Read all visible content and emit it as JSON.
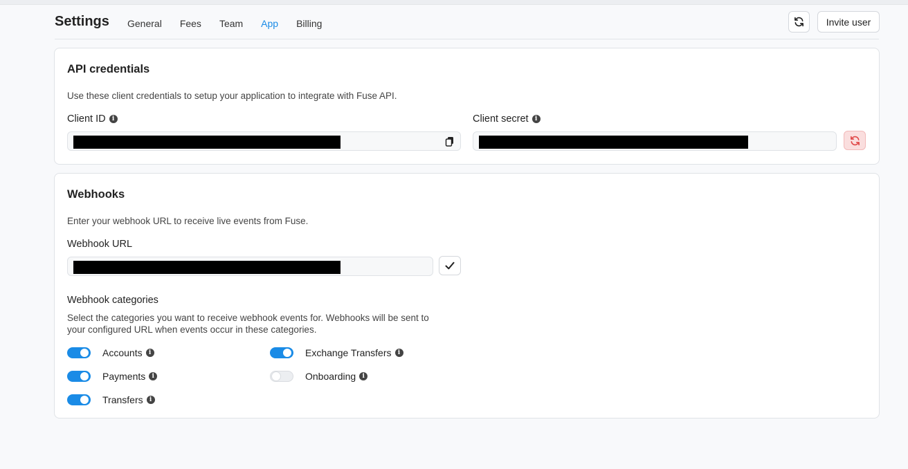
{
  "header": {
    "title": "Settings",
    "tabs": [
      {
        "label": "General",
        "active": false
      },
      {
        "label": "Fees",
        "active": false
      },
      {
        "label": "Team",
        "active": false
      },
      {
        "label": "App",
        "active": true
      },
      {
        "label": "Billing",
        "active": false
      }
    ],
    "refresh_icon": "refresh-icon",
    "invite_label": "Invite user"
  },
  "api": {
    "title": "API credentials",
    "description": "Use these client credentials to setup your application to integrate with Fuse API.",
    "client_id_label": "Client ID",
    "client_secret_label": "Client secret"
  },
  "webhooks": {
    "title": "Webhooks",
    "description": "Enter your webhook URL to receive live events from Fuse.",
    "url_label": "Webhook URL",
    "categories_title": "Webhook categories",
    "categories_description_line1": "Select the categories you want to receive webhook events for. Webhooks will be sent to",
    "categories_description_line2": "your configured URL when events occur in these categories.",
    "categories": [
      {
        "label": "Accounts",
        "enabled": true
      },
      {
        "label": "Payments",
        "enabled": true
      },
      {
        "label": "Transfers",
        "enabled": true
      },
      {
        "label": "Exchange Transfers",
        "enabled": true
      },
      {
        "label": "Onboarding",
        "enabled": false
      }
    ]
  },
  "colors": {
    "accent": "#1a8be6",
    "danger": "#e04848",
    "danger_bg": "#fadede"
  }
}
